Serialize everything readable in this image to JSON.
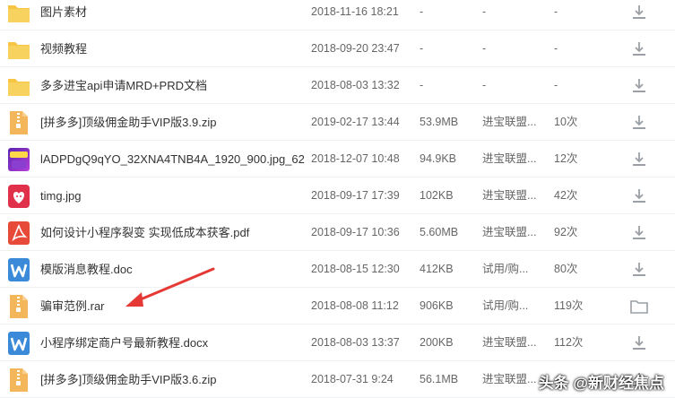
{
  "files": [
    {
      "name": "图片素材",
      "date": "2018-11-16 18:21",
      "size": "-",
      "source": "-",
      "count": "-",
      "icon": "folder-icon",
      "action": "download-icon"
    },
    {
      "name": "视频教程",
      "date": "2018-09-20 23:47",
      "size": "-",
      "source": "-",
      "count": "-",
      "icon": "folder-icon",
      "action": "download-icon"
    },
    {
      "name": "多多进宝api申请MRD+PRD文档",
      "date": "2018-08-03 13:32",
      "size": "-",
      "source": "-",
      "count": "-",
      "icon": "folder-icon",
      "action": "download-icon"
    },
    {
      "name": "[拼多多]顶级佣金助手VIP版3.9.zip",
      "date": "2019-02-17 13:44",
      "size": "53.9MB",
      "source": "进宝联盟...",
      "count": "10次",
      "icon": "zip-icon",
      "action": "download-icon"
    },
    {
      "name": "lADPDgQ9qYO_32XNA4TNB4A_1920_900.jpg_62...",
      "date": "2018-12-07 10:48",
      "size": "94.9KB",
      "source": "进宝联盟...",
      "count": "12次",
      "icon": "image-thumbnail-icon",
      "action": "download-icon"
    },
    {
      "name": "timg.jpg",
      "date": "2018-09-17 17:39",
      "size": "102KB",
      "source": "进宝联盟...",
      "count": "42次",
      "icon": "pinduoduo-logo-icon",
      "action": "download-icon"
    },
    {
      "name": "如何设计小程序裂变 实现低成本获客.pdf",
      "date": "2018-09-17 10:36",
      "size": "5.60MB",
      "source": "进宝联盟...",
      "count": "92次",
      "icon": "pdf-icon",
      "action": "download-icon"
    },
    {
      "name": "模版消息教程.doc",
      "date": "2018-08-15 12:30",
      "size": "412KB",
      "source": "试用/购...",
      "count": "80次",
      "icon": "word-doc-icon",
      "action": "download-icon"
    },
    {
      "name": "骗审范例.rar",
      "date": "2018-08-08 11:12",
      "size": "906KB",
      "source": "试用/购...",
      "count": "119次",
      "icon": "zip-icon",
      "action": "folder-outline-icon"
    },
    {
      "name": "小程序绑定商户号最新教程.docx",
      "date": "2018-08-03 13:37",
      "size": "200KB",
      "source": "进宝联盟...",
      "count": "112次",
      "icon": "word-doc-icon",
      "action": "download-icon"
    },
    {
      "name": "[拼多多]顶级佣金助手VIP版3.6.zip",
      "date": "2018-07-31 9:24",
      "size": "56.1MB",
      "source": "进宝联盟...",
      "count": "",
      "icon": "zip-icon",
      "action": "download-icon"
    }
  ],
  "watermark": "头条 @新财经焦点",
  "colors": {
    "folder": "#f5c543",
    "zip": "#f4b65a",
    "pdf": "#e84a3a",
    "word": "#3b8ad9",
    "annotation_arrow": "#e53935",
    "icon_gray": "#9aa0a6"
  }
}
